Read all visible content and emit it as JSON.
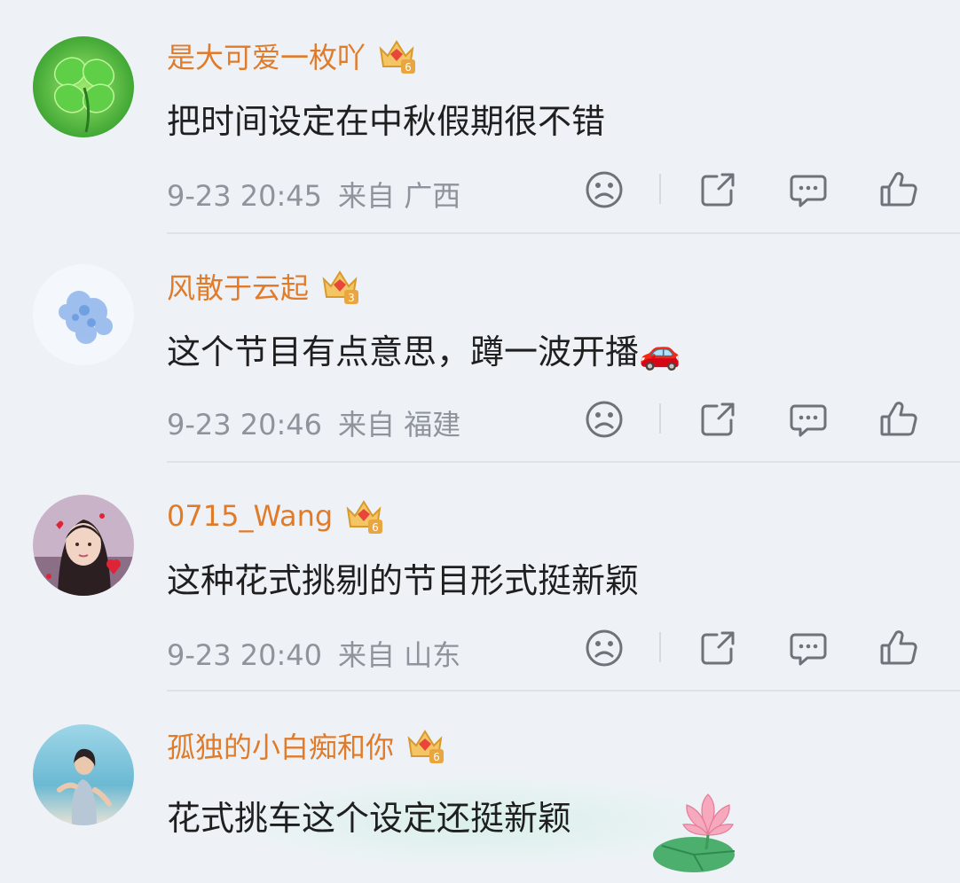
{
  "comments": [
    {
      "username": "是大可爱一枚吖",
      "badge_level": "6",
      "text": "把时间设定在中秋假期很不错",
      "time": "9-23 20:45",
      "source": "来自 广西"
    },
    {
      "username": "风散于云起",
      "badge_level": "3",
      "text": "这个节目有点意思，蹲一波开播",
      "emoji": "🚗",
      "time": "9-23 20:46",
      "source": "来自 福建"
    },
    {
      "username": "0715_Wang",
      "badge_level": "6",
      "text": "这种花式挑剔的节目形式挺新颖",
      "time": "9-23 20:40",
      "source": "来自 山东"
    },
    {
      "username": "孤独的小白痴和你",
      "badge_level": "6",
      "text": "花式挑车这个设定还挺新颖"
    }
  ],
  "icons": [
    "dislike-face-icon",
    "share-icon",
    "comment-icon",
    "like-thumb-icon",
    "crown-badge-icon",
    "lotus-sticker-icon"
  ],
  "colors": {
    "username": "#e07b2a",
    "meta": "#8f949c",
    "background": "#eef2f7"
  }
}
